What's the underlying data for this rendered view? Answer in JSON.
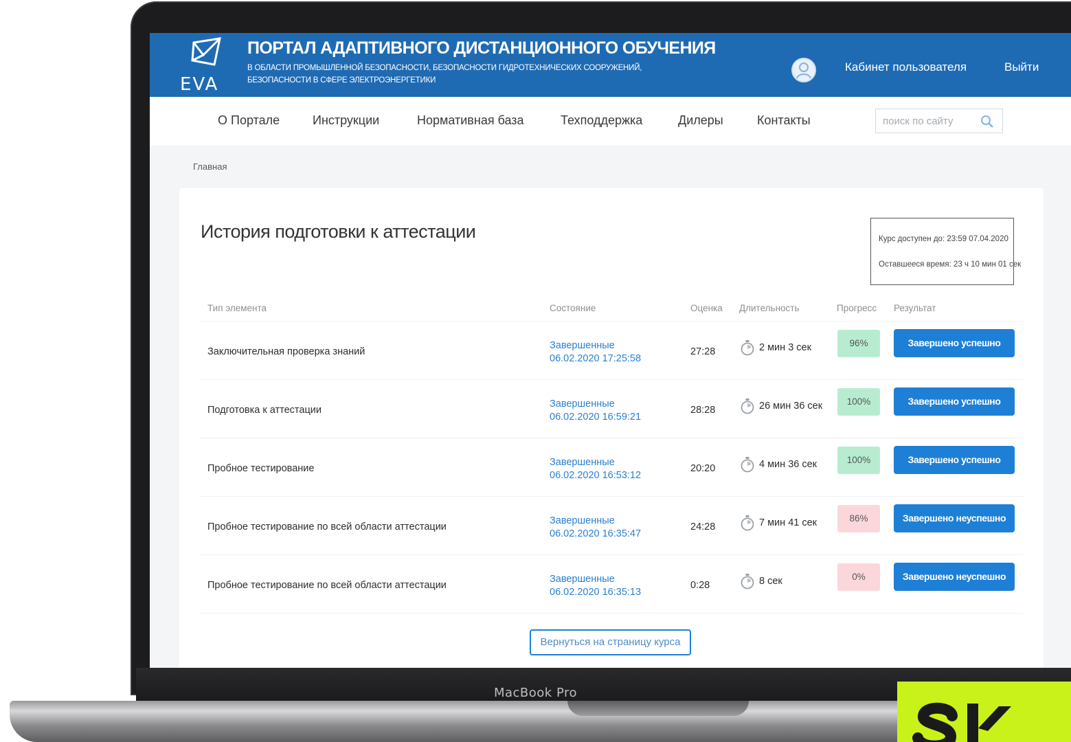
{
  "portal": {
    "logo_text": "EVA",
    "title": "ПОРТАЛ АДАПТИВНОГО ДИСТАНЦИОННОГО ОБУЧЕНИЯ",
    "subtitle_line1": "В ОБЛАСТИ ПРОМЫШЛЕННОЙ БЕЗОПАСНОСТИ, БЕЗОПАСНОСТИ ГИДРОТЕХНИЧЕСКИХ СООРУЖЕНИЙ,",
    "subtitle_line2": "БЕЗОПАСНОСТИ В СФЕРЕ ЭЛЕКТРОЭНЕРГЕТИКИ"
  },
  "user_menu": {
    "cabinet_label": "Кабинет пользователя",
    "logout_label": "Выйти"
  },
  "nav": {
    "items": [
      "О Портале",
      "Инструкции",
      "Нормативная база",
      "Техподдержка",
      "Дилеры",
      "Контакты"
    ],
    "search_placeholder": "поиск по сайту"
  },
  "breadcrumb": "Главная",
  "page": {
    "title": "История подготовки к аттестации",
    "info": {
      "available_until": "Курс доступен до: 23:59 07.04.2020",
      "remaining": "Оставшееся время: 23 ч 10 мин 01 сек"
    },
    "table": {
      "headers": {
        "type": "Тип элемента",
        "state": "Состояние",
        "score": "Оценка",
        "duration": "Длительность",
        "progress": "Прогресс",
        "result": "Результат"
      },
      "rows": [
        {
          "type": "Заключительная проверка знаний",
          "state": "Завершенные",
          "date": "06.02.2020 17:25:58",
          "score": "27:28",
          "duration": "2 мин 3 сек",
          "progress": "96%",
          "progress_status": "success",
          "result": "Завершено успешно"
        },
        {
          "type": "Подготовка к аттестации",
          "state": "Завершенные",
          "date": "06.02.2020 16:59:21",
          "score": "28:28",
          "duration": "26 мин 36 сек",
          "progress": "100%",
          "progress_status": "success",
          "result": "Завершено успешно"
        },
        {
          "type": "Пробное тестирование",
          "state": "Завершенные",
          "date": "06.02.2020 16:53:12",
          "score": "20:20",
          "duration": "4 мин 36 сек",
          "progress": "100%",
          "progress_status": "success",
          "result": "Завершено успешно"
        },
        {
          "type": "Пробное тестирование по всей области аттестации",
          "state": "Завершенные",
          "date": "06.02.2020 16:35:47",
          "score": "24:28",
          "duration": "7 мин 41 сек",
          "progress": "86%",
          "progress_status": "fail",
          "result": "Завершено неуспешно"
        },
        {
          "type": "Пробное тестирование по всей области аттестации",
          "state": "Завершенные",
          "date": "06.02.2020 16:35:13",
          "score": "0:28",
          "duration": "8 сек",
          "progress": "0%",
          "progress_status": "fail",
          "result": "Завершено неуспешно"
        }
      ]
    },
    "back_button": "Вернуться на страницу курса"
  },
  "device_label": "MacBook Pro",
  "colors": {
    "header_blue": "#1f6bb3",
    "button_blue": "#1e7fd6",
    "progress_success": "#b8ecd0",
    "progress_fail": "#fbd7dc",
    "corner_logo": "#c9f21a"
  }
}
